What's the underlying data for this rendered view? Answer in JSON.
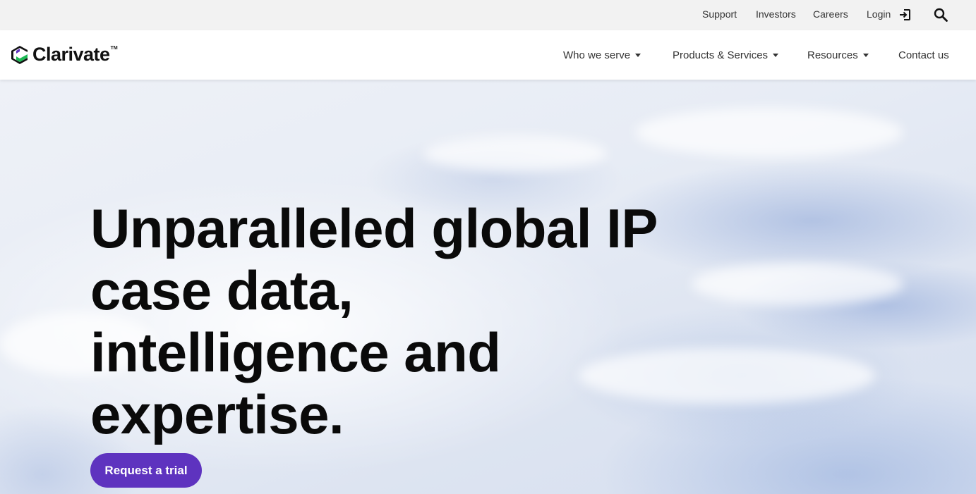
{
  "utility_nav": {
    "support": "Support",
    "investors": "Investors",
    "careers": "Careers",
    "login": "Login",
    "login_icon": "login-arrow-icon",
    "search_icon": "search-icon"
  },
  "brand": {
    "name": "Clarivate",
    "trademark": "TM",
    "colors": {
      "mark_purple": "#5e33bf",
      "mark_green": "#1db954"
    }
  },
  "main_nav": {
    "items": [
      {
        "label": "Who we serve",
        "has_dropdown": true
      },
      {
        "label": "Products & Services",
        "has_dropdown": true
      },
      {
        "label": "Resources",
        "has_dropdown": true
      },
      {
        "label": "Contact us",
        "has_dropdown": false
      }
    ]
  },
  "hero": {
    "title_lines": [
      "Unparalleled global IP",
      "case data,",
      "intelligence and",
      "expertise."
    ],
    "cta_label": "Request a trial",
    "cta_color": "#5e33bf"
  }
}
